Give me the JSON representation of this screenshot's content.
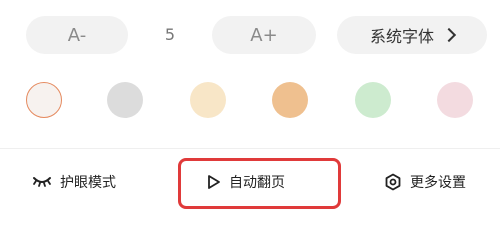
{
  "font_size": {
    "decrease_label": "A-",
    "current_value": "5",
    "increase_label": "A+"
  },
  "font_family": {
    "label": "系统字体"
  },
  "background_colors": [
    {
      "name": "white",
      "color": "#f7f2ef",
      "selected": true
    },
    {
      "name": "gray",
      "color": "#dcdcdc",
      "selected": false
    },
    {
      "name": "cream",
      "color": "#f8e6c7",
      "selected": false
    },
    {
      "name": "tan",
      "color": "#efc08f",
      "selected": false
    },
    {
      "name": "mint",
      "color": "#cdebcf",
      "selected": false
    },
    {
      "name": "pink",
      "color": "#f3dbe0",
      "selected": false
    }
  ],
  "bottom_actions": {
    "eye_care": "护眼模式",
    "auto_flip": "自动翻页",
    "more_settings": "更多设置"
  },
  "colors": {
    "highlight": "#e03a3a",
    "selected_ring": "#e58a5f",
    "pill_bg": "#f2f2f2"
  },
  "icons": {
    "eye_care": "closed-eye-icon",
    "auto_flip": "play-icon",
    "more_settings": "gear-hexagon-icon"
  }
}
